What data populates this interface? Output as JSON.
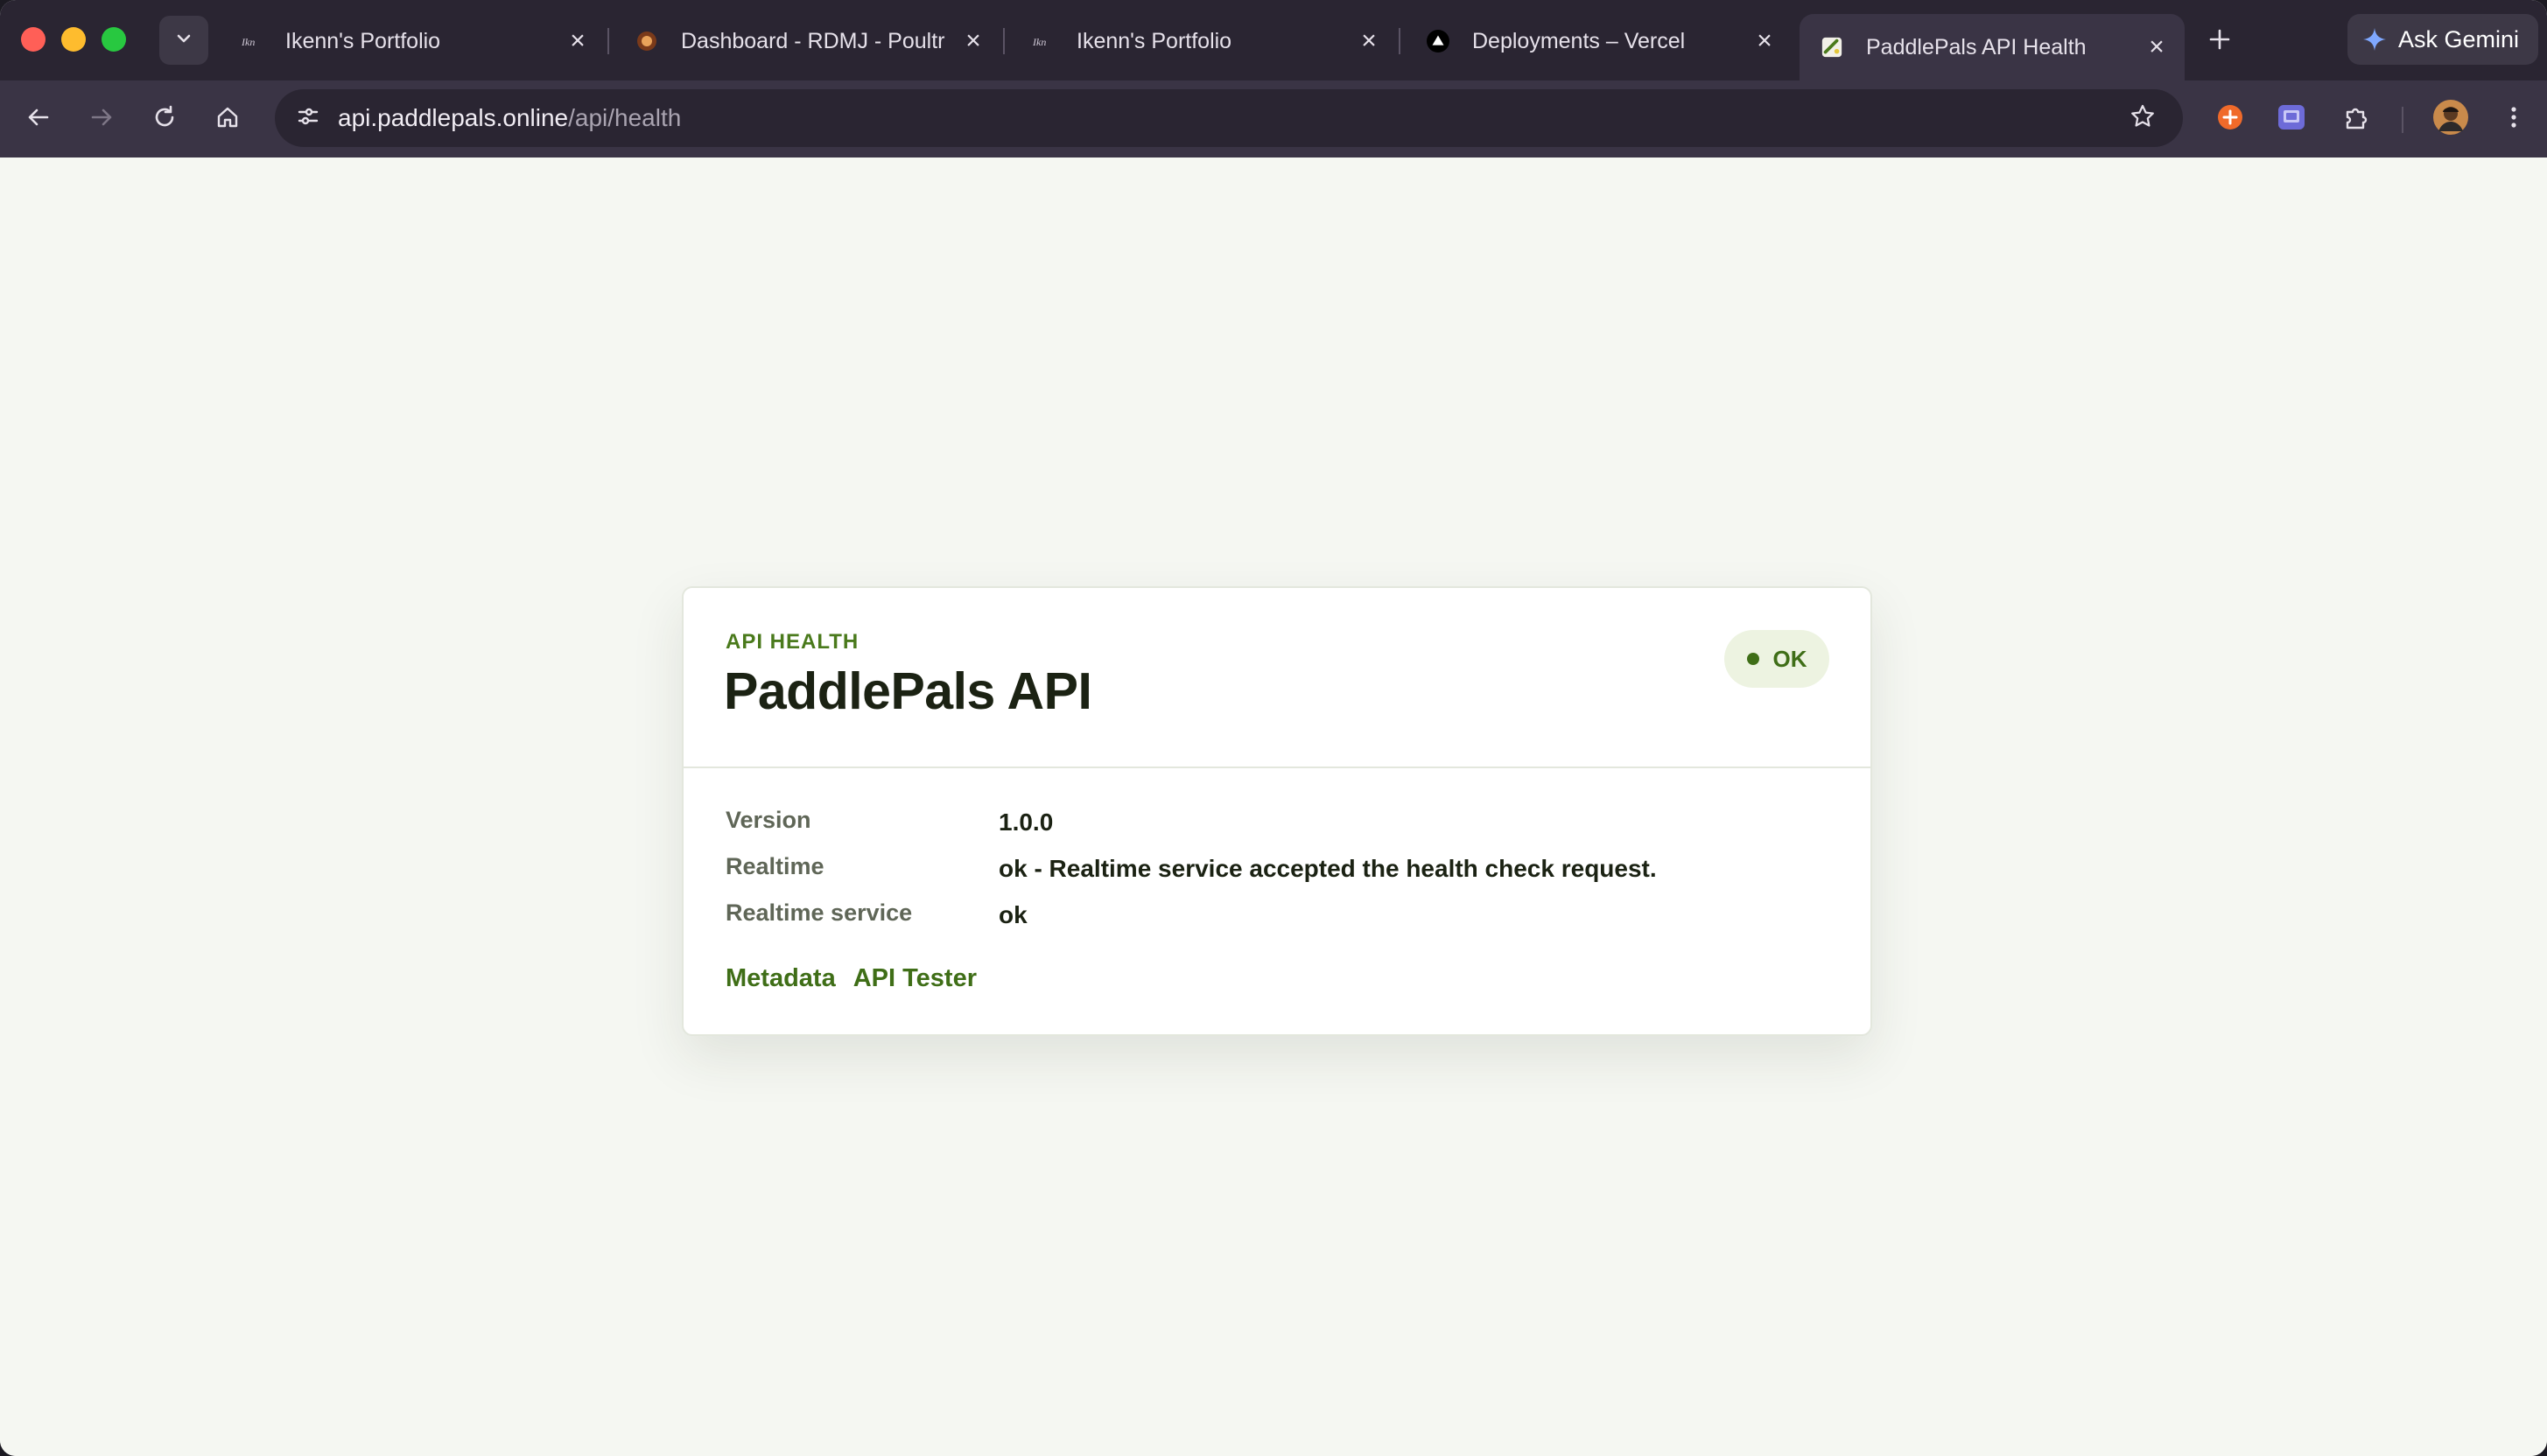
{
  "browser": {
    "tabs": [
      {
        "title": "Ikenn's Portfolio",
        "icon": "portfolio-favicon"
      },
      {
        "title": "Dashboard - RDMJ - Poultr",
        "icon": "rdmj-favicon"
      },
      {
        "title": "Ikenn's Portfolio",
        "icon": "portfolio-favicon"
      },
      {
        "title": "Deployments – Vercel",
        "icon": "vercel-favicon"
      },
      {
        "title": "PaddlePals API Health",
        "icon": "paddlepals-favicon",
        "active": true
      }
    ],
    "ask_gemini_label": "Ask Gemini",
    "address": {
      "host": "api.paddlepals.online",
      "path": "/api/health"
    }
  },
  "page": {
    "eyebrow": "API HEALTH",
    "title": "PaddlePals API",
    "status": "OK",
    "rows": [
      {
        "key": "Version",
        "value": "1.0.0"
      },
      {
        "key": "Realtime",
        "value": "ok - Realtime service accepted the health check request."
      },
      {
        "key": "Realtime service",
        "value": "ok"
      }
    ],
    "links": [
      "Metadata",
      "API Tester"
    ]
  },
  "colors": {
    "accent_green": "#3f6e17",
    "page_background": "#f5f7f2",
    "browser_chrome": "#2a2532"
  }
}
